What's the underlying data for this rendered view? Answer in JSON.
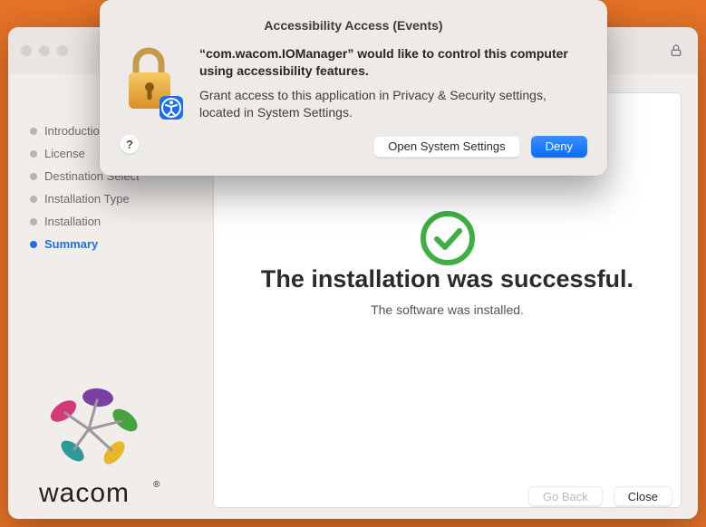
{
  "installer": {
    "titlebar": {
      "lock_icon": "lock"
    },
    "sidebar": {
      "steps": [
        {
          "label": "Introduction",
          "active": false
        },
        {
          "label": "License",
          "active": false
        },
        {
          "label": "Destination Select",
          "active": false
        },
        {
          "label": "Installation Type",
          "active": false
        },
        {
          "label": "Installation",
          "active": false
        },
        {
          "label": "Summary",
          "active": true
        }
      ],
      "brand": "wacom",
      "brand_mark": "®"
    },
    "main": {
      "success_title": "The installation was successful.",
      "success_sub": "The software was installed."
    },
    "footer": {
      "go_back_label": "Go Back",
      "close_label": "Close"
    }
  },
  "modal": {
    "title": "Accessibility Access (Events)",
    "heading": "“com.wacom.IOManager” would like to control this computer using accessibility features.",
    "description": "Grant access to this application in Privacy & Security settings, located in System Settings.",
    "help_label": "?",
    "buttons": {
      "open_settings": "Open System Settings",
      "deny": "Deny"
    },
    "icon": "lock-with-accessibility-badge"
  }
}
